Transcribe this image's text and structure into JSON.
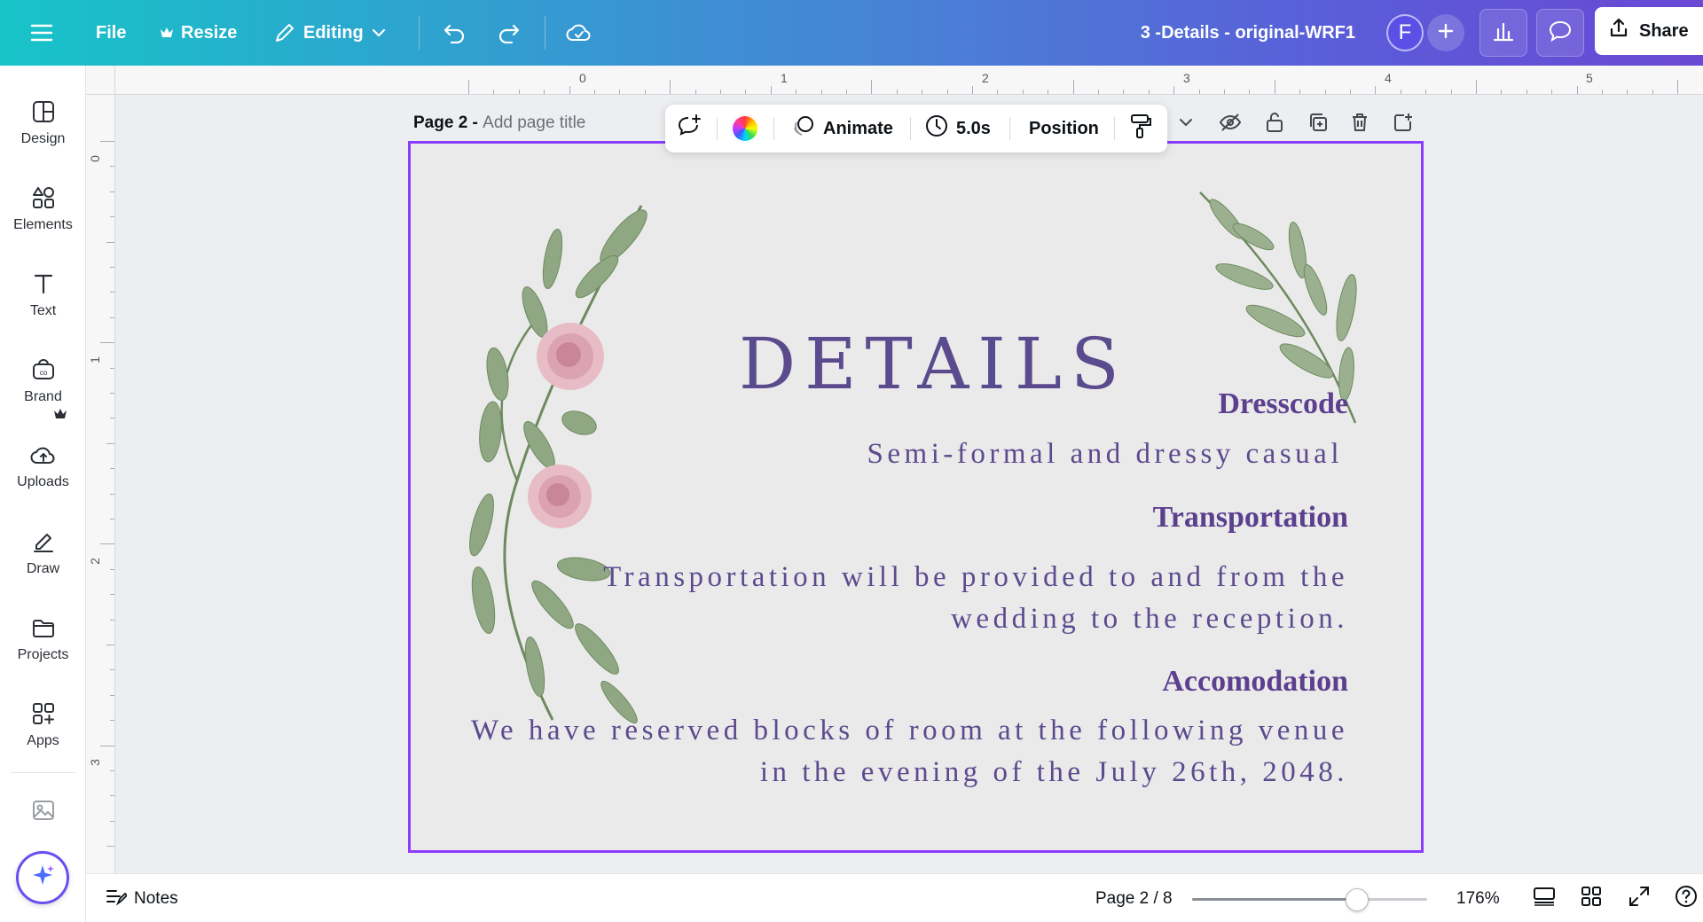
{
  "topbar": {
    "menu_icon": "hamburger-icon",
    "file_label": "File",
    "resize_label": "Resize",
    "editing_label": "Editing",
    "doc_title": "3 -Details - original-WRF1",
    "avatar_initial": "F",
    "share_label": "Share"
  },
  "rail": {
    "items": [
      {
        "label": "Design",
        "icon": "design-icon"
      },
      {
        "label": "Elements",
        "icon": "elements-icon"
      },
      {
        "label": "Text",
        "icon": "text-icon"
      },
      {
        "label": "Brand",
        "icon": "brand-icon"
      },
      {
        "label": "Uploads",
        "icon": "uploads-icon"
      },
      {
        "label": "Draw",
        "icon": "draw-icon"
      },
      {
        "label": "Projects",
        "icon": "projects-icon"
      },
      {
        "label": "Apps",
        "icon": "apps-icon"
      }
    ]
  },
  "ruler": {
    "top_labels": [
      "0",
      "1",
      "2",
      "3",
      "4",
      "5"
    ],
    "left_labels": [
      "0",
      "1",
      "2",
      "3"
    ]
  },
  "page": {
    "label_prefix": "Page 2 - ",
    "title_placeholder": "Add page title"
  },
  "context_bar": {
    "animate_label": "Animate",
    "duration_label": "5.0s",
    "position_label": "Position"
  },
  "design": {
    "heading": "DETAILS",
    "sections": [
      {
        "title": "Dresscode",
        "lines": [
          "Semi-formal and dressy casual"
        ]
      },
      {
        "title": "Transportation",
        "lines": [
          "Transportation will be provided to and from  the",
          "wedding to the reception."
        ]
      },
      {
        "title": "Accomodation",
        "lines": [
          "We have reserved blocks of room at the following venue",
          "in the evening of the July 26th, 2048."
        ]
      }
    ]
  },
  "bottombar": {
    "notes_label": "Notes",
    "page_indicator": "Page 2 / 8",
    "zoom_label": "176%",
    "zoom_fraction": 0.7
  },
  "colors": {
    "accent": "#8b3dff",
    "heading_text": "#5a4a8e",
    "section_title": "#5c3f8e"
  }
}
